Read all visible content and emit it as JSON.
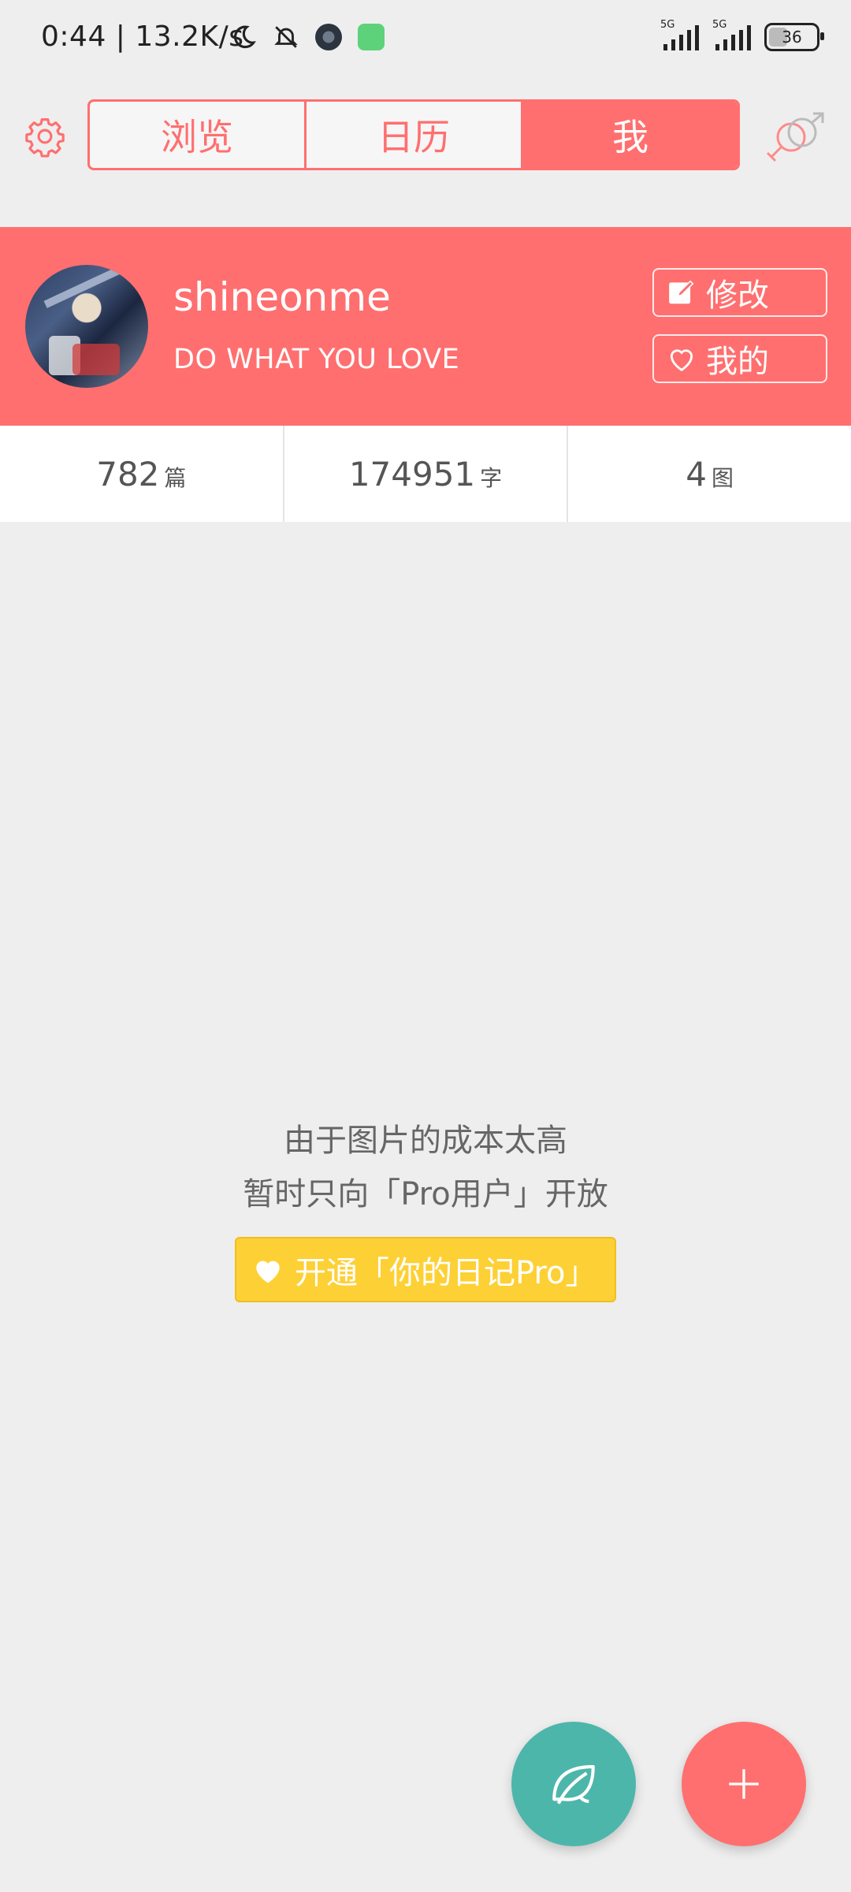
{
  "status_bar": {
    "time_speed": "0:44 | 13.2K/s",
    "battery": "36",
    "network_1": "5G",
    "network_2": "5G"
  },
  "header": {
    "tabs": [
      "浏览",
      "日历",
      "我"
    ],
    "active_tab": "我"
  },
  "profile": {
    "username": "shineonme",
    "motto": "DO WHAT YOU LOVE",
    "edit_label": "修改",
    "mine_label": "我的"
  },
  "stats": [
    {
      "value": "782",
      "unit": "篇"
    },
    {
      "value": "174951",
      "unit": "字"
    },
    {
      "value": "4",
      "unit": "图"
    }
  ],
  "message": {
    "line1": "由于图片的成本太高",
    "line2": "暂时只向「Pro用户」开放",
    "button": "开通「你的日记Pro」"
  },
  "colors": {
    "accent": "#ff6f6f",
    "teal": "#4db6ab",
    "pro_yellow": "#fdd035",
    "background": "#eeeeee"
  },
  "icons": [
    "settings-gear-icon",
    "gender-symbol-icon",
    "edit-icon",
    "heart-icon",
    "leaf-icon",
    "plus-icon"
  ]
}
